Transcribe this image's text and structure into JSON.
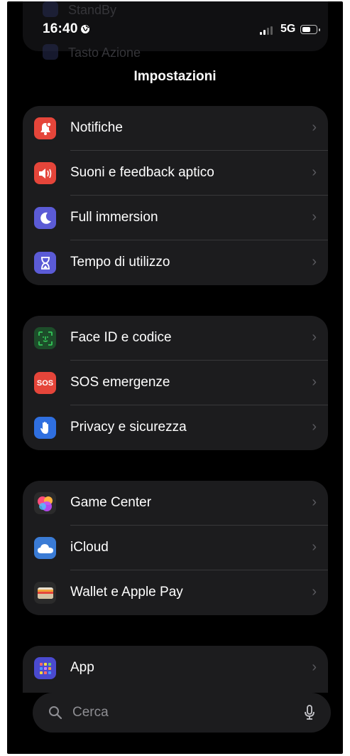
{
  "status": {
    "time": "16:40",
    "network": "5G"
  },
  "background_rows": [
    "StandBy",
    "Tasto Azione"
  ],
  "header": {
    "title": "Impostazioni"
  },
  "groups": [
    {
      "items": [
        {
          "label": "Notifiche",
          "icon": "bell-icon",
          "color": "#e5453a"
        },
        {
          "label": "Suoni e feedback aptico",
          "icon": "speaker-icon",
          "color": "#e5453a"
        },
        {
          "label": "Full immersion",
          "icon": "moon-icon",
          "color": "#5b5bd6"
        },
        {
          "label": "Tempo di utilizzo",
          "icon": "hourglass-icon",
          "color": "#5b5bd6"
        }
      ]
    },
    {
      "items": [
        {
          "label": "Face ID e codice",
          "icon": "face-id-icon",
          "color": "#34c759"
        },
        {
          "label": "SOS emergenze",
          "icon": "sos-icon",
          "icon_text": "SOS",
          "color": "#e5453a"
        },
        {
          "label": "Privacy e sicurezza",
          "icon": "hand-icon",
          "color": "#2f6fe0"
        }
      ]
    },
    {
      "items": [
        {
          "label": "Game Center",
          "icon": "game-center-icon",
          "color": "#ff5a8a"
        },
        {
          "label": "iCloud",
          "icon": "cloud-icon",
          "color": "#3a7bd5"
        },
        {
          "label": "Wallet e Apple Pay",
          "icon": "wallet-icon",
          "color": "#2b2b2b"
        }
      ]
    },
    {
      "items": [
        {
          "label": "App",
          "icon": "apps-grid-icon",
          "color": "#4a4ad0"
        }
      ]
    }
  ],
  "search": {
    "placeholder": "Cerca"
  }
}
